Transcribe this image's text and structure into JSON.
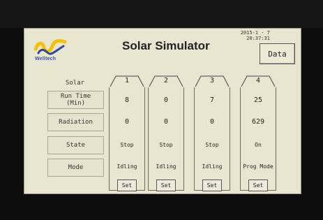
{
  "header": {
    "brand": "Welltech",
    "title": "Solar Simulator",
    "date": "2015-1 - 7",
    "time": "20:37:31",
    "data_button": "Data"
  },
  "rows": {
    "solar": "Solar",
    "run_time_line1": "Run Time",
    "run_time_line2": "(Min)",
    "radiation": "Radiation",
    "state": "State",
    "mode": "Mode"
  },
  "units": [
    {
      "number": "1",
      "run_time": "8",
      "radiation": "0",
      "state": "Stop",
      "mode": "Idling",
      "set": "Set"
    },
    {
      "number": "2",
      "run_time": "0",
      "radiation": "0",
      "state": "Stop",
      "mode": "Idling",
      "set": "Set"
    },
    {
      "number": "3",
      "run_time": "7",
      "radiation": "0",
      "state": "Stop",
      "mode": "Idling",
      "set": "Set"
    },
    {
      "number": "4",
      "run_time": "25",
      "radiation": "629",
      "state": "On",
      "mode": "Prog Mode",
      "set": "Set"
    }
  ],
  "icons": {
    "logo": "welltech-logo-icon"
  }
}
